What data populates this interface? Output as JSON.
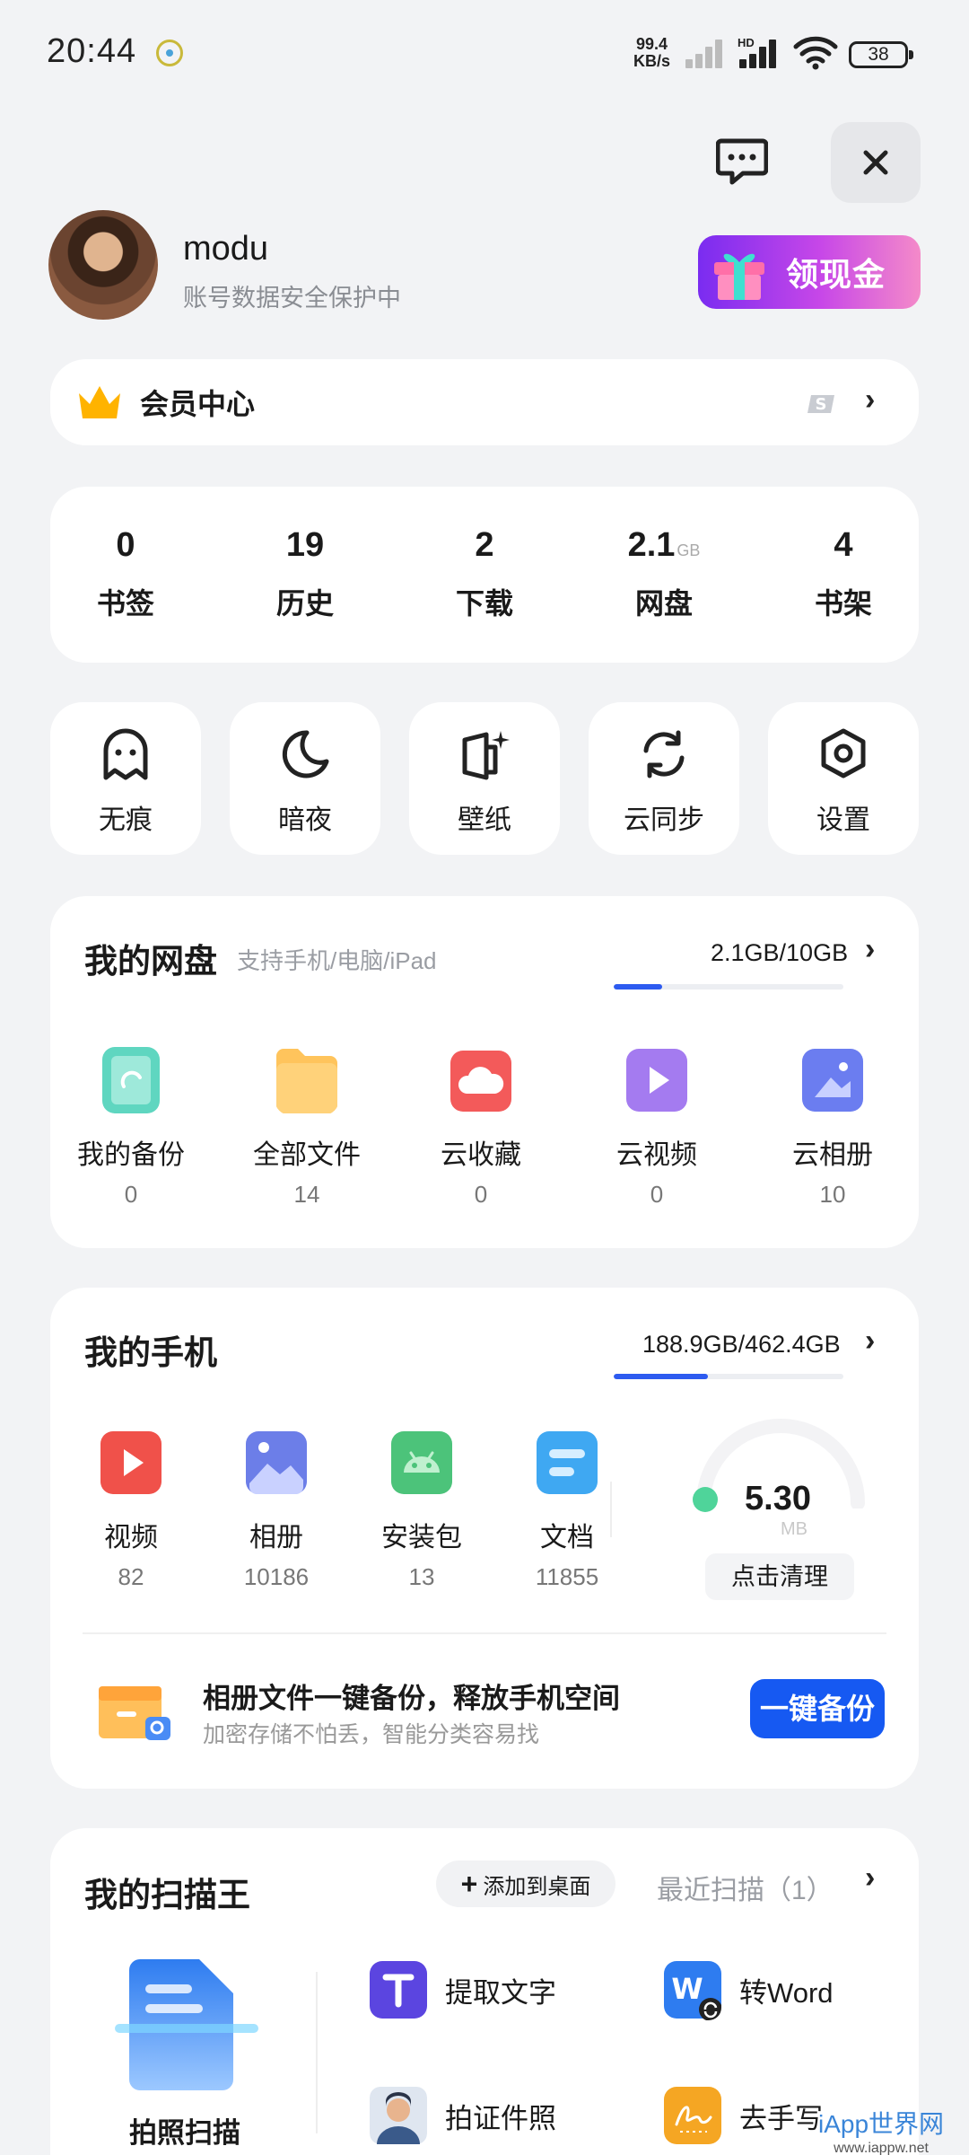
{
  "status_bar": {
    "time": "20:44",
    "net_speed": "99.4",
    "net_unit": "KB/s",
    "hd": "HD",
    "battery": "38"
  },
  "profile": {
    "name": "modu",
    "subtitle": "账号数据安全保护中",
    "cash_button": "领现金"
  },
  "vip": {
    "label": "会员中心"
  },
  "stats": [
    {
      "value": "0",
      "unit": "",
      "label": "书签"
    },
    {
      "value": "19",
      "unit": "",
      "label": "历史"
    },
    {
      "value": "2",
      "unit": "",
      "label": "下载"
    },
    {
      "value": "2.1",
      "unit": "GB",
      "label": "网盘"
    },
    {
      "value": "4",
      "unit": "",
      "label": "书架"
    }
  ],
  "tools": [
    {
      "label": "无痕",
      "icon": "ghost-icon"
    },
    {
      "label": "暗夜",
      "icon": "moon-icon"
    },
    {
      "label": "壁纸",
      "icon": "wallpaper-icon"
    },
    {
      "label": "云同步",
      "icon": "sync-icon"
    },
    {
      "label": "设置",
      "icon": "settings-icon"
    }
  ],
  "cloud_disk": {
    "title": "我的网盘",
    "subtitle": "支持手机/电脑/iPad",
    "usage": "2.1GB/10GB",
    "usage_fraction": 0.21,
    "items": [
      {
        "label": "我的备份",
        "count": "0",
        "color": "#5fd6c0"
      },
      {
        "label": "全部文件",
        "count": "14",
        "color": "#ffc45c"
      },
      {
        "label": "云收藏",
        "count": "0",
        "color": "#f35a5a"
      },
      {
        "label": "云视频",
        "count": "0",
        "color": "#a47bf0"
      },
      {
        "label": "云相册",
        "count": "10",
        "color": "#6b7df0"
      }
    ]
  },
  "my_phone": {
    "title": "我的手机",
    "usage": "188.9GB/462.4GB",
    "usage_fraction": 0.41,
    "items": [
      {
        "label": "视频",
        "count": "82",
        "color": "#f0514a"
      },
      {
        "label": "相册",
        "count": "10186",
        "color": "#6c7ee8"
      },
      {
        "label": "安装包",
        "count": "13",
        "color": "#4cc37a"
      },
      {
        "label": "文档",
        "count": "11855",
        "color": "#3fa8f2"
      }
    ],
    "junk_value": "5.30",
    "junk_unit": "MB",
    "clean_button": "点击清理",
    "backup_title": "相册文件一键备份，释放手机空间",
    "backup_subtitle": "加密存储不怕丢，智能分类容易找",
    "backup_button": "一键备份"
  },
  "scanner": {
    "title": "我的扫描王",
    "add_desktop": "添加到桌面",
    "recent": "最近扫描（1）",
    "main_label": "拍照扫描",
    "features": [
      {
        "label": "提取文字",
        "color": "#5b45e0"
      },
      {
        "label": "转Word",
        "color": "#2e7cf0"
      },
      {
        "label": "拍证件照",
        "color": "#dfe6f0"
      },
      {
        "label": "去手写",
        "color": "#f5a623"
      }
    ]
  },
  "watermark": {
    "main": "iApp世界网",
    "url": "www.iappw.net"
  },
  "colors": {
    "accent": "#1659f2",
    "background": "#f2f3f5"
  }
}
